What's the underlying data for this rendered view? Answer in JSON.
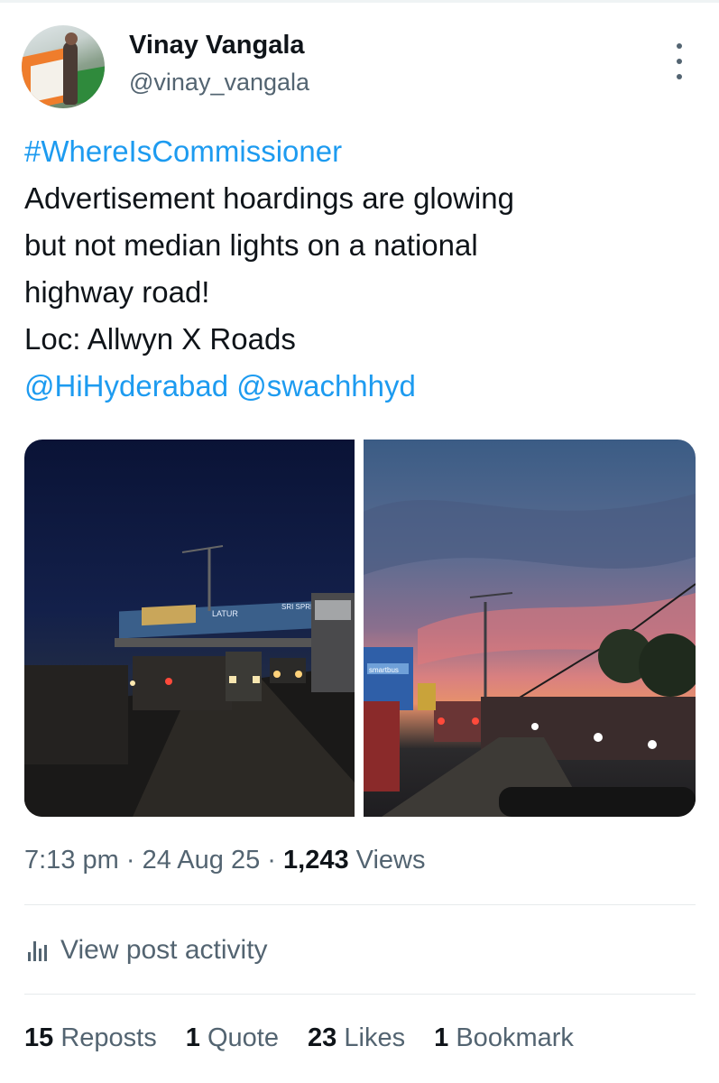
{
  "author": {
    "name": "Vinay Vangala",
    "handle": "@vinay_vangala"
  },
  "tweet": {
    "hashtag": "#WhereIsCommissioner",
    "lines": [
      "Advertisement hoardings are glowing",
      "but not median lights on a national",
      "highway road!",
      "Loc: Allwyn X Roads"
    ],
    "mentions": "@HiHyderabad @swachhhyd"
  },
  "media": {
    "left_photo_signs": [
      "LATUR",
      "SRI SPRING"
    ],
    "right_photo_sign": "smartbus"
  },
  "meta": {
    "time": "7:13 pm",
    "separator": "·",
    "date": "24 Aug 25",
    "views_count": "1,243",
    "views_label": "Views"
  },
  "activity": {
    "label": "View post activity"
  },
  "stats": [
    {
      "count": "15",
      "label": "Reposts"
    },
    {
      "count": "1",
      "label": "Quote"
    },
    {
      "count": "23",
      "label": "Likes"
    },
    {
      "count": "1",
      "label": "Bookmark"
    }
  ],
  "colors": {
    "link": "#1d9bf0",
    "secondary_text": "#536471",
    "primary_text": "#0f1419"
  }
}
